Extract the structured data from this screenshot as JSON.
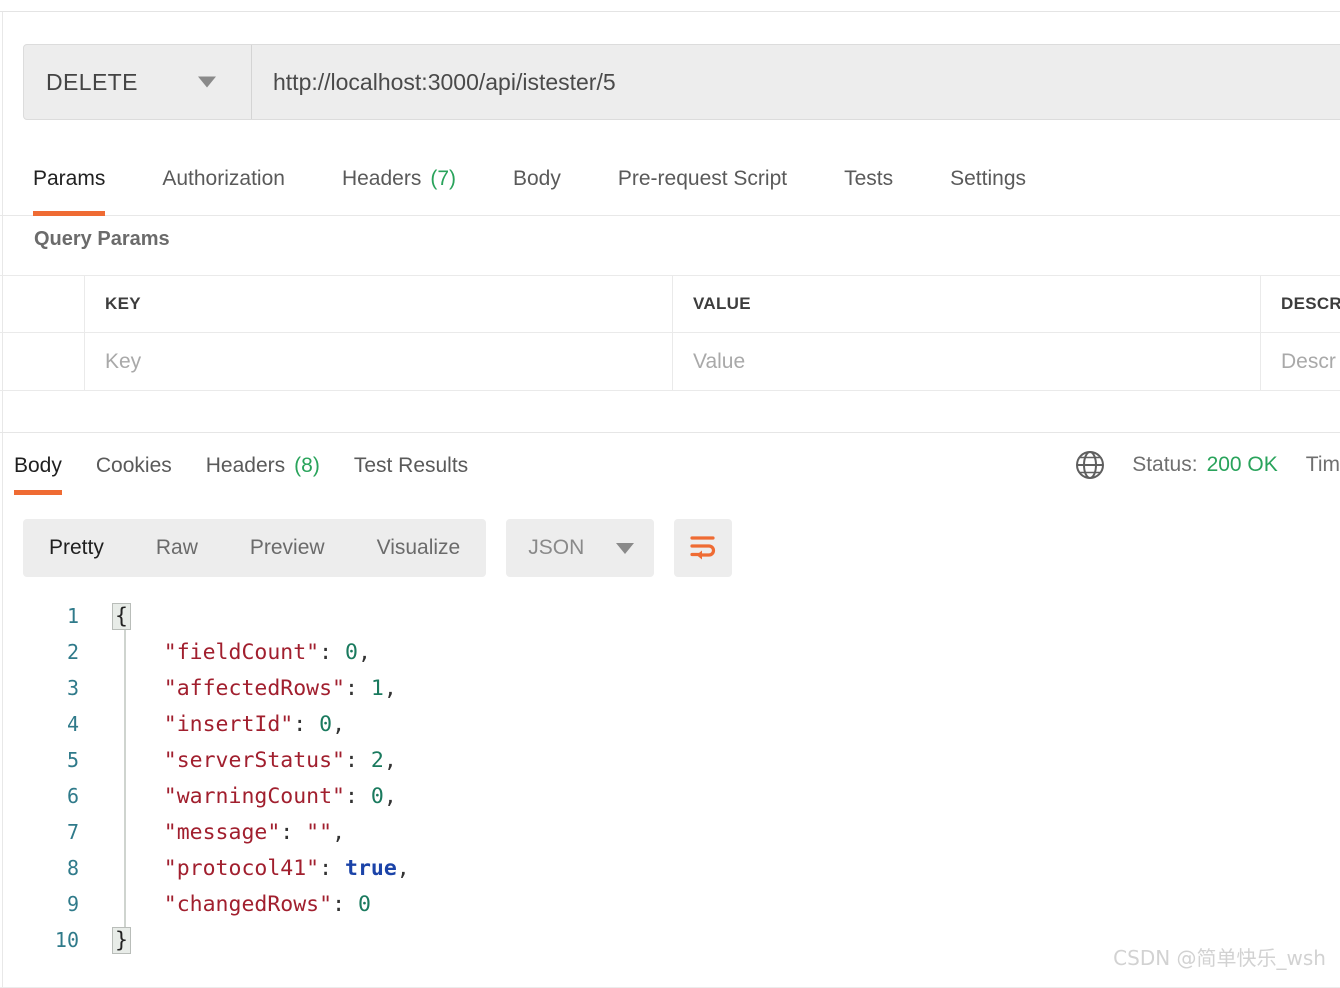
{
  "request": {
    "method": "DELETE",
    "url": "http://localhost:3000/api/istester/5",
    "method_caret_icon": "chevron-down-icon",
    "tabs": [
      {
        "label": "Params",
        "active": true
      },
      {
        "label": "Authorization",
        "active": false
      },
      {
        "label": "Headers",
        "count": "(7)",
        "active": false
      },
      {
        "label": "Body",
        "active": false
      },
      {
        "label": "Pre-request Script",
        "active": false
      },
      {
        "label": "Tests",
        "active": false
      },
      {
        "label": "Settings",
        "active": false
      }
    ]
  },
  "query_params": {
    "section_title": "Query Params",
    "columns": [
      "KEY",
      "VALUE",
      "DESCR"
    ],
    "rows": [
      {
        "key_placeholder": "Key",
        "value_placeholder": "Value",
        "description_placeholder": "Descr"
      }
    ]
  },
  "response": {
    "tabs": [
      {
        "label": "Body",
        "active": true
      },
      {
        "label": "Cookies",
        "active": false
      },
      {
        "label": "Headers",
        "count": "(8)",
        "active": false
      },
      {
        "label": "Test Results",
        "active": false
      }
    ],
    "globe_icon": "globe-icon",
    "status_label": "Status:",
    "status_value": "200 OK",
    "status_color": "#29a35b",
    "time_label": "Tim",
    "toolbar": {
      "views": [
        {
          "label": "Pretty",
          "active": true
        },
        {
          "label": "Raw",
          "active": false
        },
        {
          "label": "Preview",
          "active": false
        },
        {
          "label": "Visualize",
          "active": false
        }
      ],
      "format": "JSON",
      "format_caret_icon": "chevron-down-icon",
      "wrap_icon": "wrap-lines-icon",
      "wrap_icon_color": "#ef6b33"
    },
    "body_lines": [
      {
        "num": "1",
        "segments": [
          {
            "t": "brace",
            "v": "{"
          }
        ]
      },
      {
        "num": "2",
        "segments": [
          {
            "t": "p",
            "v": "    "
          },
          {
            "t": "k",
            "v": "\"fieldCount\""
          },
          {
            "t": "p",
            "v": ": "
          },
          {
            "t": "n",
            "v": "0"
          },
          {
            "t": "p",
            "v": ","
          }
        ]
      },
      {
        "num": "3",
        "segments": [
          {
            "t": "p",
            "v": "    "
          },
          {
            "t": "k",
            "v": "\"affectedRows\""
          },
          {
            "t": "p",
            "v": ": "
          },
          {
            "t": "n",
            "v": "1"
          },
          {
            "t": "p",
            "v": ","
          }
        ]
      },
      {
        "num": "4",
        "segments": [
          {
            "t": "p",
            "v": "    "
          },
          {
            "t": "k",
            "v": "\"insertId\""
          },
          {
            "t": "p",
            "v": ": "
          },
          {
            "t": "n",
            "v": "0"
          },
          {
            "t": "p",
            "v": ","
          }
        ]
      },
      {
        "num": "5",
        "segments": [
          {
            "t": "p",
            "v": "    "
          },
          {
            "t": "k",
            "v": "\"serverStatus\""
          },
          {
            "t": "p",
            "v": ": "
          },
          {
            "t": "n",
            "v": "2"
          },
          {
            "t": "p",
            "v": ","
          }
        ]
      },
      {
        "num": "6",
        "segments": [
          {
            "t": "p",
            "v": "    "
          },
          {
            "t": "k",
            "v": "\"warningCount\""
          },
          {
            "t": "p",
            "v": ": "
          },
          {
            "t": "n",
            "v": "0"
          },
          {
            "t": "p",
            "v": ","
          }
        ]
      },
      {
        "num": "7",
        "segments": [
          {
            "t": "p",
            "v": "    "
          },
          {
            "t": "k",
            "v": "\"message\""
          },
          {
            "t": "p",
            "v": ": "
          },
          {
            "t": "s",
            "v": "\"\""
          },
          {
            "t": "p",
            "v": ","
          }
        ]
      },
      {
        "num": "8",
        "segments": [
          {
            "t": "p",
            "v": "    "
          },
          {
            "t": "k",
            "v": "\"protocol41\""
          },
          {
            "t": "p",
            "v": ": "
          },
          {
            "t": "b",
            "v": "true"
          },
          {
            "t": "p",
            "v": ","
          }
        ]
      },
      {
        "num": "9",
        "segments": [
          {
            "t": "p",
            "v": "    "
          },
          {
            "t": "k",
            "v": "\"changedRows\""
          },
          {
            "t": "p",
            "v": ": "
          },
          {
            "t": "n",
            "v": "0"
          }
        ]
      },
      {
        "num": "10",
        "segments": [
          {
            "t": "brace",
            "v": "}"
          }
        ]
      }
    ]
  },
  "watermark": "CSDN @简单快乐_wsh",
  "colors": {
    "accent": "#ef6b33",
    "success": "#29a35b",
    "json_key": "#a11f2e",
    "json_number": "#1a7a5e",
    "json_boolean": "#1b43a8"
  }
}
